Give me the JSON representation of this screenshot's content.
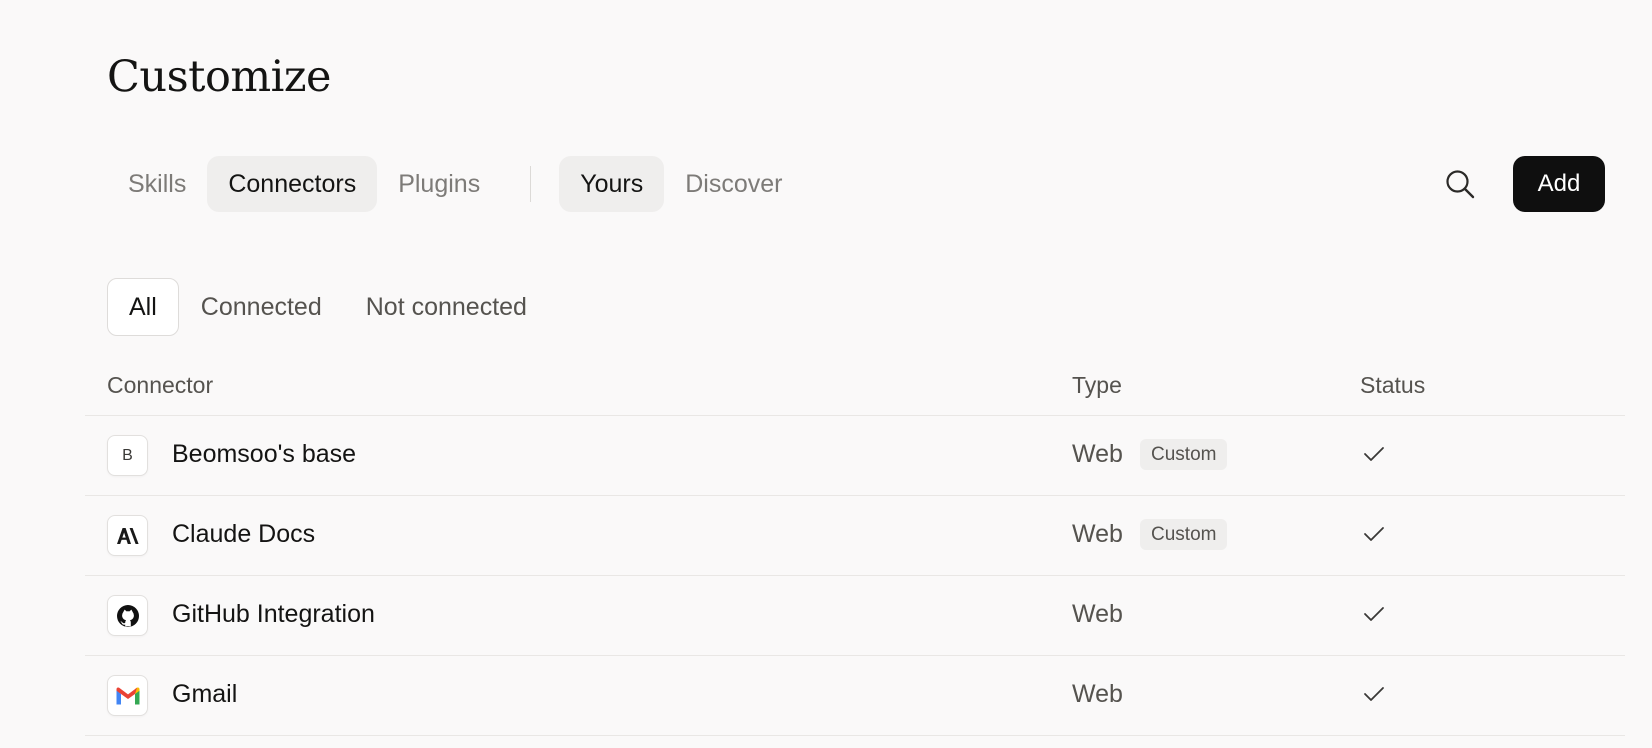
{
  "header": {
    "title": "Customize"
  },
  "tabs": {
    "primary": [
      {
        "label": "Skills",
        "active": false
      },
      {
        "label": "Connectors",
        "active": true
      },
      {
        "label": "Plugins",
        "active": false
      }
    ],
    "secondary": [
      {
        "label": "Yours",
        "active": true
      },
      {
        "label": "Discover",
        "active": false
      }
    ]
  },
  "toolbar": {
    "search_icon": "search-icon",
    "add_label": "Add"
  },
  "filters": [
    {
      "label": "All",
      "active": true
    },
    {
      "label": "Connected",
      "active": false
    },
    {
      "label": "Not connected",
      "active": false
    }
  ],
  "table": {
    "columns": [
      "Connector",
      "Type",
      "Status"
    ],
    "rows": [
      {
        "name": "Beomsoo's base",
        "logo": "letter-B",
        "logo_text": "B",
        "type": "Web",
        "badge": "Custom",
        "status": "check-icon"
      },
      {
        "name": "Claude Docs",
        "logo": "anthropic-logo",
        "type": "Web",
        "badge": "Custom",
        "status": "check-icon"
      },
      {
        "name": "GitHub Integration",
        "logo": "github-logo",
        "type": "Web",
        "badge": "",
        "status": "check-icon"
      },
      {
        "name": "Gmail",
        "logo": "gmail-logo",
        "type": "Web",
        "badge": "",
        "status": "check-icon"
      }
    ]
  },
  "colors": {
    "background": "#faf9f9",
    "active_pill": "#efeeed",
    "add_button": "#0f0f0f",
    "text_primary": "#141413",
    "text_muted": "#7d7b78"
  }
}
